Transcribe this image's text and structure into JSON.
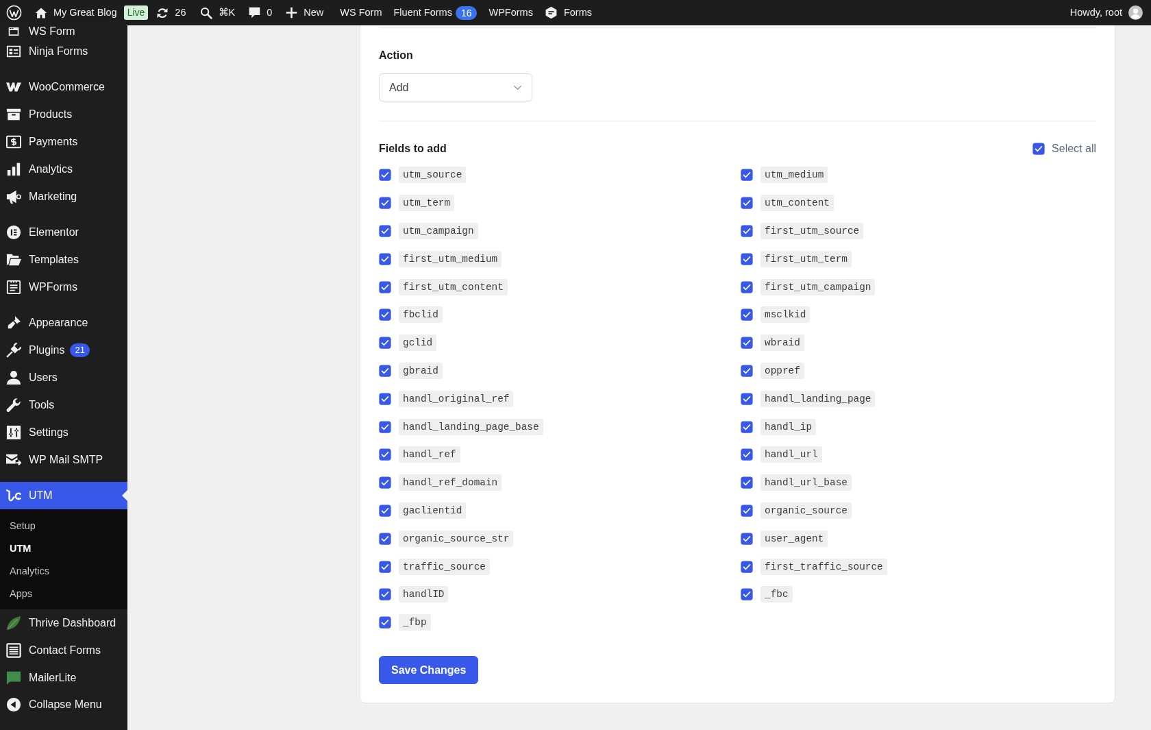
{
  "admin_bar": {
    "site_name": "My Great Blog",
    "live_badge": "Live",
    "updates": "26",
    "search_shortcut": "⌘K",
    "comments": "0",
    "new_label": "New",
    "menus": [
      {
        "kind": "text",
        "label": "WS Form"
      },
      {
        "kind": "text",
        "label": "Fluent Forms",
        "badge": "16"
      },
      {
        "kind": "text",
        "label": "WPForms"
      },
      {
        "kind": "icon",
        "label": "Forms"
      }
    ],
    "greeting": "Howdy, root"
  },
  "sidebar": {
    "groups": [
      {
        "items": [
          {
            "label": "WS Form",
            "selected": false
          },
          {
            "label": "Ninja Forms",
            "selected": false
          }
        ]
      },
      {
        "items": [
          {
            "label": "WooCommerce",
            "selected": false
          },
          {
            "label": "Products",
            "selected": false
          },
          {
            "label": "Payments",
            "selected": false
          },
          {
            "label": "Analytics",
            "selected": false
          },
          {
            "label": "Marketing",
            "selected": false
          }
        ]
      },
      {
        "items": [
          {
            "label": "Elementor",
            "selected": false
          },
          {
            "label": "Templates",
            "selected": false
          },
          {
            "label": "WPForms",
            "selected": false
          }
        ]
      },
      {
        "items": [
          {
            "label": "Appearance",
            "selected": false
          },
          {
            "label": "Plugins",
            "badge": "21",
            "selected": false
          },
          {
            "label": "Users",
            "selected": false
          },
          {
            "label": "Tools",
            "selected": false
          },
          {
            "label": "Settings",
            "selected": false
          },
          {
            "label": "WP Mail SMTP",
            "selected": false
          }
        ]
      },
      {
        "items": [
          {
            "label": "UTM",
            "selected": true,
            "children": [
              {
                "label": "Setup",
                "selected": false
              },
              {
                "label": "UTM",
                "selected": true
              },
              {
                "label": "Analytics",
                "selected": false
              },
              {
                "label": "Apps",
                "selected": false
              }
            ]
          },
          {
            "label": "Thrive Dashboard",
            "selected": false
          },
          {
            "label": "Contact Forms",
            "selected": false
          },
          {
            "label": "MailerLite",
            "selected": false
          }
        ]
      }
    ],
    "collapse_label": "Collapse Menu"
  },
  "settings": {
    "action": {
      "label": "Action",
      "value": "Add"
    },
    "fields": {
      "title": "Fields to add",
      "select_all": {
        "label": "Select all",
        "checked": true
      },
      "items": [
        {
          "name": "utm_source",
          "checked": true
        },
        {
          "name": "utm_medium",
          "checked": true
        },
        {
          "name": "utm_term",
          "checked": true
        },
        {
          "name": "utm_content",
          "checked": true
        },
        {
          "name": "utm_campaign",
          "checked": true
        },
        {
          "name": "first_utm_source",
          "checked": true
        },
        {
          "name": "first_utm_medium",
          "checked": true
        },
        {
          "name": "first_utm_term",
          "checked": true
        },
        {
          "name": "first_utm_content",
          "checked": true
        },
        {
          "name": "first_utm_campaign",
          "checked": true
        },
        {
          "name": "fbclid",
          "checked": true
        },
        {
          "name": "msclkid",
          "checked": true
        },
        {
          "name": "gclid",
          "checked": true
        },
        {
          "name": "wbraid",
          "checked": true
        },
        {
          "name": "gbraid",
          "checked": true
        },
        {
          "name": "oppref",
          "checked": true
        },
        {
          "name": "handl_original_ref",
          "checked": true
        },
        {
          "name": "handl_landing_page",
          "checked": true
        },
        {
          "name": "handl_landing_page_base",
          "checked": true
        },
        {
          "name": "handl_ip",
          "checked": true
        },
        {
          "name": "handl_ref",
          "checked": true
        },
        {
          "name": "handl_url",
          "checked": true
        },
        {
          "name": "handl_ref_domain",
          "checked": true
        },
        {
          "name": "handl_url_base",
          "checked": true
        },
        {
          "name": "gaclientid",
          "checked": true
        },
        {
          "name": "organic_source",
          "checked": true
        },
        {
          "name": "organic_source_str",
          "checked": true
        },
        {
          "name": "user_agent",
          "checked": true
        },
        {
          "name": "traffic_source",
          "checked": true
        },
        {
          "name": "first_traffic_source",
          "checked": true
        },
        {
          "name": "handlID",
          "checked": true
        },
        {
          "name": "_fbc",
          "checked": true
        },
        {
          "name": "_fbp",
          "checked": true
        }
      ]
    },
    "save_button": "Save Changes"
  }
}
